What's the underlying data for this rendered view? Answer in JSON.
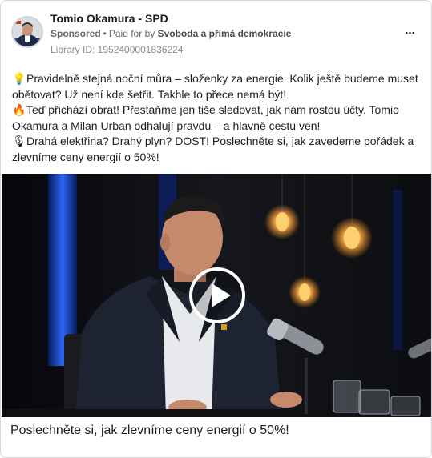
{
  "ad": {
    "page_name": "Tomio Okamura - SPD",
    "sponsored_label": "Sponsored",
    "dot": "•",
    "paid_for_label": "Paid for by",
    "payer": "Svoboda a přímá demokracie",
    "library_id": "Library ID: 1952400001836224",
    "more_icon": "more-horizontal-icon",
    "more_label": "•••"
  },
  "body": {
    "paragraphs": [
      {
        "emoji": "💡",
        "icon": "lightbulb-icon",
        "text": "Pravidelně stejná noční můra – složenky za energie. Kolik ještě budeme muset obětovat? Už není kde šetřit. Takhle to přece nemá být!"
      },
      {
        "emoji": "🔥",
        "icon": "fire-icon",
        "text": "Teď přichází obrat! Přestaňme jen tiše sledovat, jak nám rostou účty. Tomio Okamura a Milan Urban odhalují pravdu – a hlavně cestu ven!"
      },
      {
        "emoji": "🎙",
        "icon": "microphone-icon",
        "text": "Drahá elektřina? Drahý plyn? DOST! Poslechněte si, jak zavedeme pořádek a zlevníme ceny energií o 50%!"
      }
    ]
  },
  "video": {
    "play_icon": "play-icon"
  },
  "caption": {
    "text": "Poslechněte si, jak zlevníme ceny energií o 50%!"
  },
  "colors": {
    "text_primary": "#1c1e21",
    "text_secondary": "#65676b",
    "border": "#d4d6da",
    "video_bg": "#0b0c0f",
    "blue_light": "#2d6bff",
    "bulb_glow": "#ffb347"
  }
}
